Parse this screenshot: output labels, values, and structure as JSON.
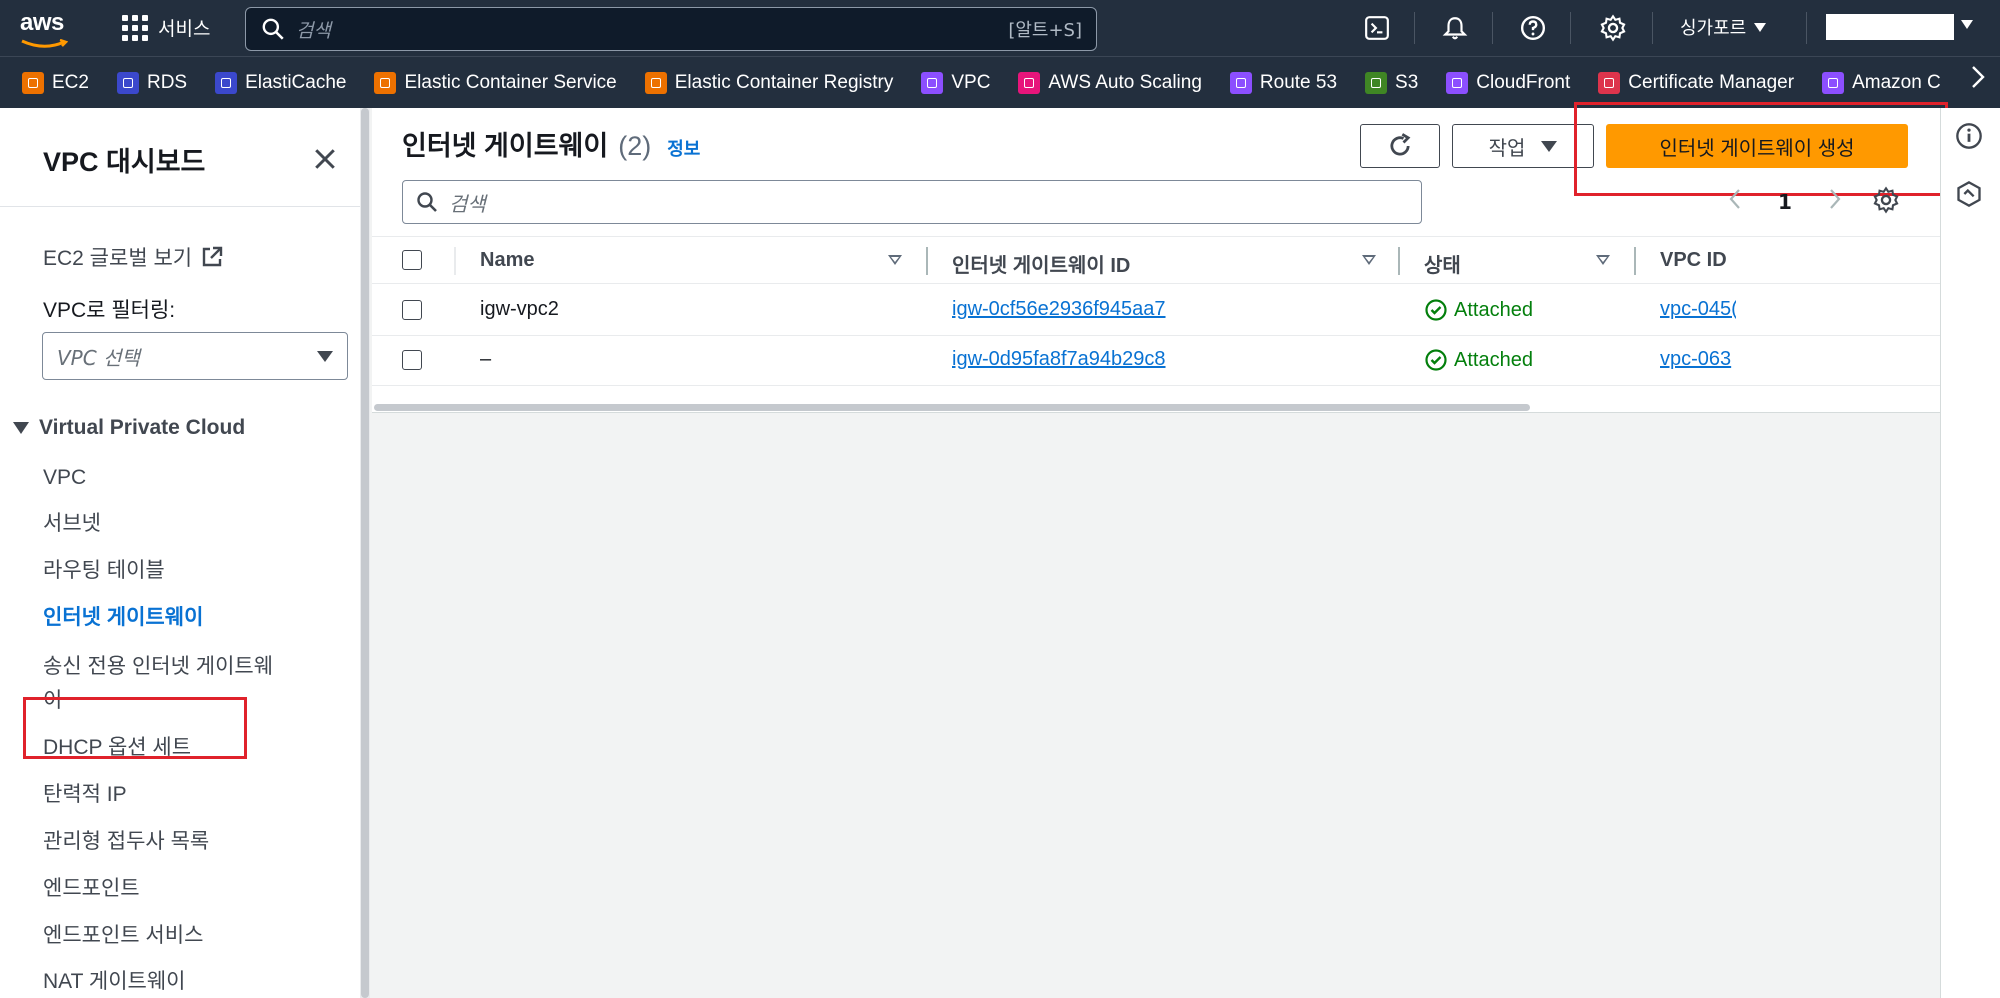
{
  "topnav": {
    "logo_text": "aws",
    "services_label": "서비스",
    "search_placeholder": "검색",
    "search_shortcut": "[알트+S]",
    "region_label": "싱가포르",
    "icons": [
      "cloudshell-icon",
      "bell-icon",
      "help-icon",
      "settings-icon"
    ]
  },
  "favorites": [
    {
      "label": "EC2",
      "color": "#ed7100"
    },
    {
      "label": "RDS",
      "color": "#3b48cc"
    },
    {
      "label": "ElastiCache",
      "color": "#3b48cc"
    },
    {
      "label": "Elastic Container Service",
      "color": "#ed7100"
    },
    {
      "label": "Elastic Container Registry",
      "color": "#ed7100"
    },
    {
      "label": "VPC",
      "color": "#8c4fff"
    },
    {
      "label": "AWS Auto Scaling",
      "color": "#e7157b"
    },
    {
      "label": "Route 53",
      "color": "#8c4fff"
    },
    {
      "label": "S3",
      "color": "#3f8624"
    },
    {
      "label": "CloudFront",
      "color": "#8c4fff"
    },
    {
      "label": "Certificate Manager",
      "color": "#dd344c"
    },
    {
      "label": "Amazon C",
      "color": "#8c4fff"
    }
  ],
  "sidebar": {
    "title": "VPC 대시보드",
    "global_view": "EC2 글로벌 보기",
    "filter_label": "VPC로 필터링:",
    "filter_placeholder": "VPC 선택",
    "section": "Virtual Private Cloud",
    "items": [
      {
        "label": "VPC",
        "active": false
      },
      {
        "label": "서브넷",
        "active": false
      },
      {
        "label": "라우팅 테이블",
        "active": false
      },
      {
        "label": "인터넷 게이트웨이",
        "active": true
      },
      {
        "label": "송신 전용 인터넷 게이트웨",
        "active": false
      },
      {
        "label": "이",
        "active": false
      },
      {
        "label": "DHCP 옵션 세트",
        "active": false
      },
      {
        "label": "탄력적 IP",
        "active": false
      },
      {
        "label": "관리형 접두사 목록",
        "active": false
      },
      {
        "label": "엔드포인트",
        "active": false
      },
      {
        "label": "엔드포인트 서비스",
        "active": false
      },
      {
        "label": "NAT 게이트웨이",
        "active": false
      }
    ]
  },
  "main": {
    "title": "인터넷 게이트웨이",
    "count": "(2)",
    "info_link": "정보",
    "actions_label": "작업",
    "create_label": "인터넷 게이트웨이 생성",
    "filter_placeholder": "검색",
    "page_number": "1",
    "columns": [
      "Name",
      "인터넷 게이트웨이 ID",
      "상태",
      "VPC ID"
    ],
    "rows": [
      {
        "name": "igw-vpc2",
        "id": "igw-0cf56e2936f945aa7",
        "state": "Attached",
        "vpc": "vpc-045("
      },
      {
        "name": "–",
        "id": "igw-0d95fa8f7a94b29c8",
        "state": "Attached",
        "vpc": "vpc-063"
      }
    ]
  },
  "colors": {
    "nav_bg": "#232f3e",
    "accent_orange": "#ff9900",
    "link_blue": "#0972d3",
    "success_green": "#037f0c",
    "highlight_red": "#e0222b"
  }
}
